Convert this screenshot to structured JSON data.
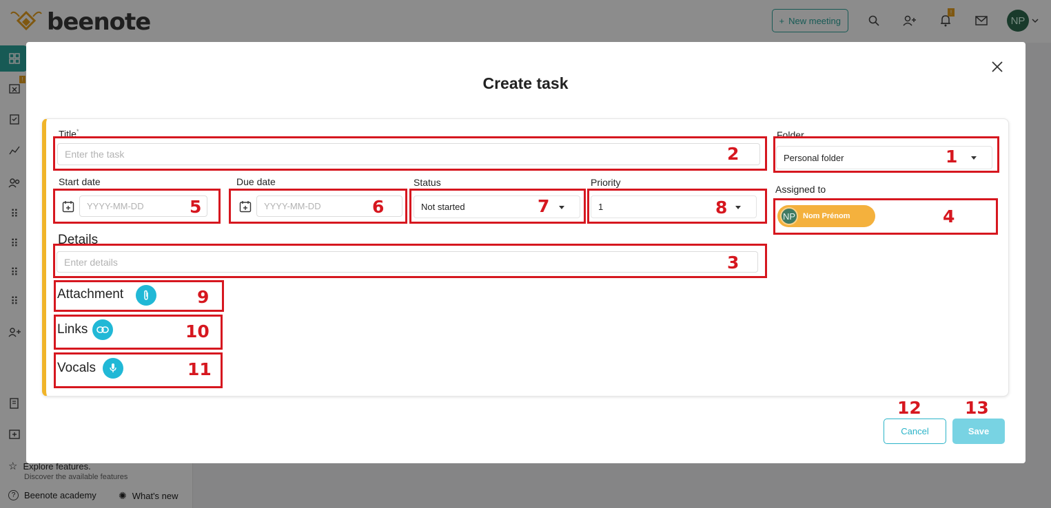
{
  "app": {
    "logo_text": "beenote",
    "new_meeting_label": "New meeting",
    "notification_badge": "!",
    "user_initials": "NP",
    "sidebar_badge": "!",
    "explore_title": "Explore features.",
    "explore_subtitle": "Discover the available features",
    "academy_label": "Beenote academy",
    "whats_new_label": "What's new"
  },
  "modal": {
    "title": "Create task",
    "fields": {
      "title_label": "Title",
      "title_required_mark": "*",
      "title_placeholder": "Enter the task",
      "folder_label": "Folder",
      "folder_value": "Personal folder",
      "start_date_label": "Start date",
      "start_date_placeholder": "YYYY-MM-DD",
      "due_date_label": "Due date",
      "due_date_placeholder": "YYYY-MM-DD",
      "status_label": "Status",
      "status_value": "Not started",
      "priority_label": "Priority",
      "priority_value": "1",
      "assigned_label": "Assigned to",
      "assignee_initials": "NP",
      "assignee_name": "Nom Prénom",
      "details_label": "Details",
      "details_placeholder": "Enter details",
      "attachment_label": "Attachment",
      "links_label": "Links",
      "vocals_label": "Vocals"
    },
    "buttons": {
      "cancel": "Cancel",
      "save": "Save"
    }
  },
  "annotations": [
    "1",
    "2",
    "3",
    "4",
    "5",
    "6",
    "7",
    "8",
    "9",
    "10",
    "11",
    "12",
    "13"
  ],
  "colors": {
    "accent_teal": "#2aa59c",
    "accent_cyan": "#21b8d6",
    "card_stripe": "#f0b429",
    "chip_orange": "#f4b13d",
    "annotation_red": "#d6171f"
  }
}
